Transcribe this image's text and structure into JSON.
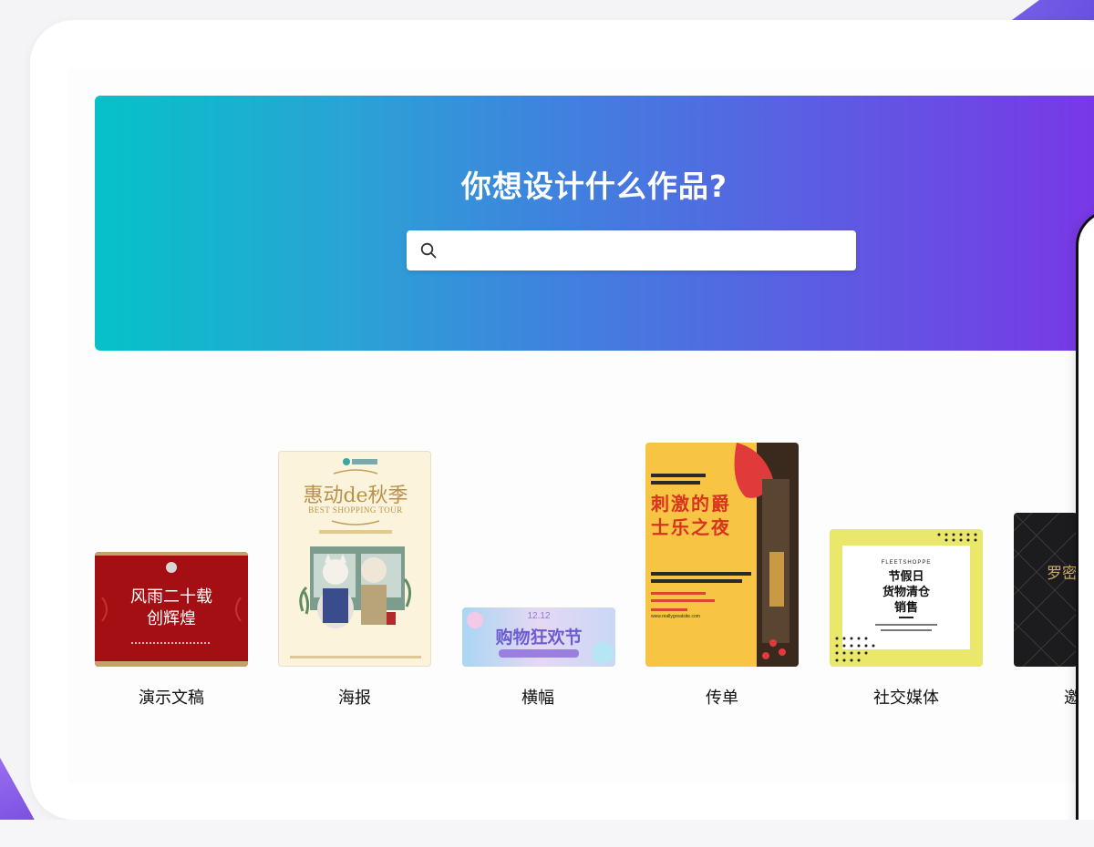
{
  "hero": {
    "title": "你想设计什么作品?",
    "search_placeholder": ""
  },
  "categories": [
    {
      "label": "演示文稿",
      "thumb": {
        "lines": [
          "风雨二十载",
          "创辉煌"
        ]
      }
    },
    {
      "label": "海报",
      "thumb": {
        "title": "惠动de秋季",
        "subtitle": "BEST SHOPPING TOUR"
      }
    },
    {
      "label": "横幅",
      "thumb": {
        "date": "12.12",
        "title": "购物狂欢节"
      }
    },
    {
      "label": "传单",
      "thumb": {
        "title": "刺激的爵士乐之夜",
        "small_caption": "www.reallygreatsite.com"
      }
    },
    {
      "label": "社交媒体",
      "thumb": {
        "brand": "FLEETSHOPPE",
        "lines": [
          "节假日",
          "货物清仓",
          "销售"
        ]
      }
    },
    {
      "label": "邀",
      "thumb": {
        "text": "罗密"
      }
    }
  ],
  "colors": {
    "hero_start": "#05c2c8",
    "hero_end": "#7a36e6",
    "presentation_red": "#a30f12",
    "poster_bg": "#fbf3dc",
    "flyer_yellow": "#f7c543",
    "social_yellow": "#e9e86a",
    "dark_tile": "#1c1c1e"
  }
}
